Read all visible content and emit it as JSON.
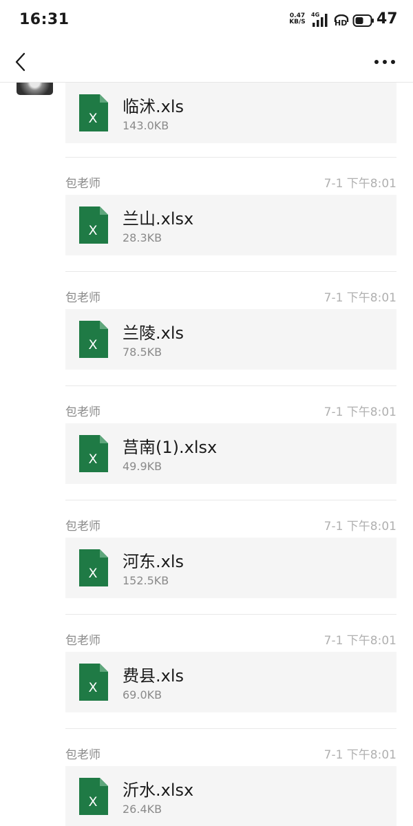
{
  "status_bar": {
    "time": "16:31",
    "net_speed_value": "0.47",
    "net_speed_unit": "KB/S",
    "network_type": "4G",
    "hd_label": "HD",
    "battery_level": "47"
  },
  "colors": {
    "excel_green": "#1f7a45",
    "card_bg": "#f5f5f5",
    "secondary_text": "#8a8a8a"
  },
  "top_partial_file": {
    "name": "临沭.xls",
    "size": "143.0KB"
  },
  "messages": [
    {
      "sender": "包老师",
      "time": "7-1 下午8:01",
      "file_name": "兰山.xlsx",
      "file_size": "28.3KB"
    },
    {
      "sender": "包老师",
      "time": "7-1 下午8:01",
      "file_name": "兰陵.xls",
      "file_size": "78.5KB"
    },
    {
      "sender": "包老师",
      "time": "7-1 下午8:01",
      "file_name": "莒南(1).xlsx",
      "file_size": "49.9KB"
    },
    {
      "sender": "包老师",
      "time": "7-1 下午8:01",
      "file_name": "河东.xls",
      "file_size": "152.5KB"
    },
    {
      "sender": "包老师",
      "time": "7-1 下午8:01",
      "file_name": "费县.xls",
      "file_size": "69.0KB"
    },
    {
      "sender": "包老师",
      "time": "7-1 下午8:01",
      "file_name": "沂水.xlsx",
      "file_size": "26.4KB"
    }
  ],
  "icons": {
    "back": "chevron-left-icon",
    "more": "more-dots-icon",
    "file": "excel-file-icon"
  }
}
